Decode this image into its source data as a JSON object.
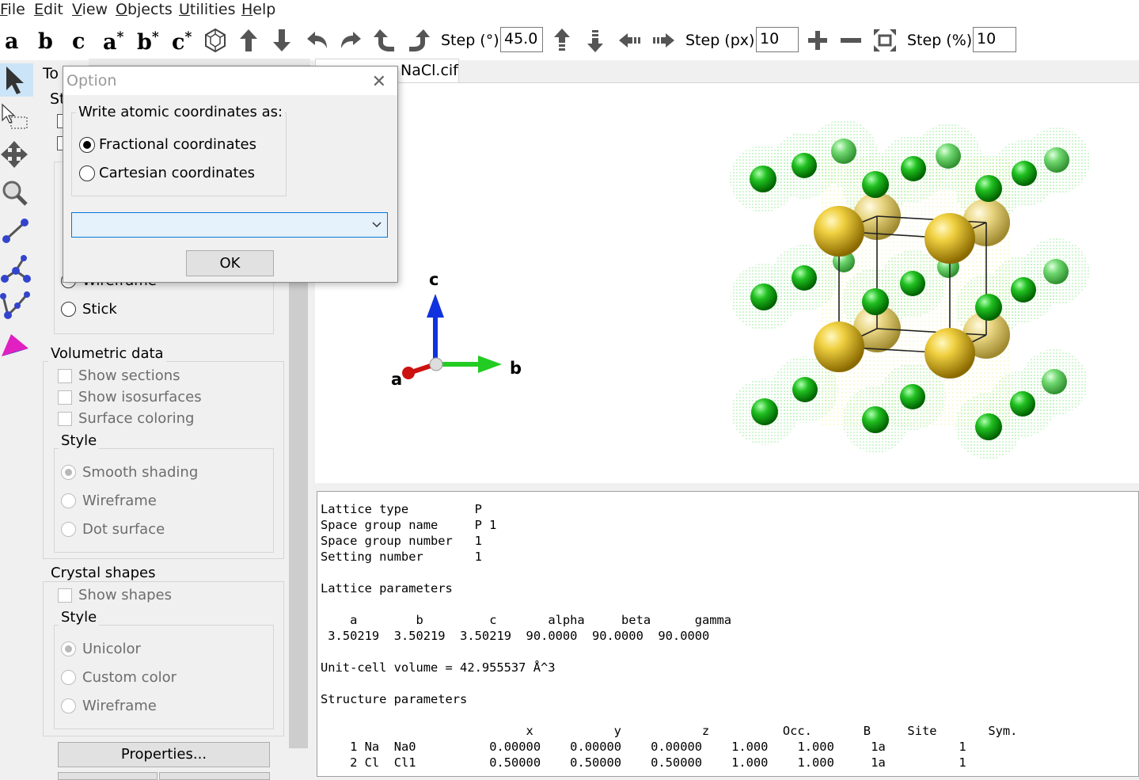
{
  "menu": [
    "File",
    "Edit",
    "View",
    "Objects",
    "Utilities",
    "Help"
  ],
  "menu_accel": [
    "F",
    "E",
    "V",
    "O",
    "U",
    "H"
  ],
  "toolbar": {
    "axes": {
      "a": "a",
      "b": "b",
      "c": "c",
      "astar": "a",
      "bstar": "b",
      "cstar": "c",
      "star": "*"
    },
    "step_deg_label": "Step (°):",
    "step_deg_value": "45.0",
    "step_px_label": "Step (px):",
    "step_px_value": "10",
    "step_pct_label": "Step (%):",
    "step_pct_value": "10"
  },
  "side_panel": {
    "tab_partial": "To",
    "style_partial": "St",
    "wireframe": "Wireframe",
    "stick": "Stick",
    "volumetric": {
      "title": "Volumetric data",
      "show_sections": "Show sections",
      "show_isosurfaces": "Show isosurfaces",
      "surface_coloring": "Surface coloring",
      "style_title": "Style",
      "smooth_shading": "Smooth shading",
      "wireframe": "Wireframe",
      "dot_surface": "Dot surface"
    },
    "crystal": {
      "title": "Crystal shapes",
      "show_shapes": "Show shapes",
      "style_title": "Style",
      "unicolor": "Unicolor",
      "custom_color": "Custom color",
      "wireframe": "Wireframe"
    },
    "properties_button": "Properties..."
  },
  "doc_tab": "NaCl.cif",
  "axes_labels": {
    "a": "a",
    "b": "b",
    "c": "c"
  },
  "output_text": {
    "lattice_type_label": "Lattice type",
    "lattice_type": "P",
    "sg_name_label": "Space group name",
    "sg_name": "P 1",
    "sg_number_label": "Space group number",
    "sg_number": "1",
    "setting_label": "Setting number",
    "setting": "1",
    "lattice_params_title": "Lattice parameters",
    "lattice_headers": [
      "a",
      "b",
      "c",
      "alpha",
      "beta",
      "gamma"
    ],
    "lattice_values": [
      "3.50219",
      "3.50219",
      "3.50219",
      "90.0000",
      "90.0000",
      "90.0000"
    ],
    "volume_line": "Unit-cell volume = 42.955537 Å^3",
    "structure_title": "Structure parameters",
    "structure_headers": [
      "x",
      "y",
      "z",
      "Occ.",
      "B",
      "Site",
      "Sym."
    ],
    "atoms": [
      [
        "1",
        "Na",
        "Na0",
        "0.00000",
        "0.00000",
        "0.00000",
        "1.000",
        "1.000",
        "1a",
        "1"
      ],
      [
        "2",
        "Cl",
        "Cl1",
        "0.50000",
        "0.50000",
        "0.50000",
        "1.000",
        "1.000",
        "1a",
        "1"
      ]
    ]
  },
  "dialog": {
    "title": "Option",
    "close_glyph": "✕",
    "group_title": "Write atomic coordinates as:",
    "fractional": "Fractional coordinates",
    "cartesian": "Cartesian coordinates",
    "selected": "fractional",
    "combo_value": "",
    "ok": "OK"
  },
  "colors": {
    "na_atom": "#e0c030",
    "cl_atom": "#22c022",
    "axis_a": "#cc1111",
    "axis_b": "#22cc22",
    "axis_c": "#1133dd",
    "accent": "#0078d7"
  }
}
